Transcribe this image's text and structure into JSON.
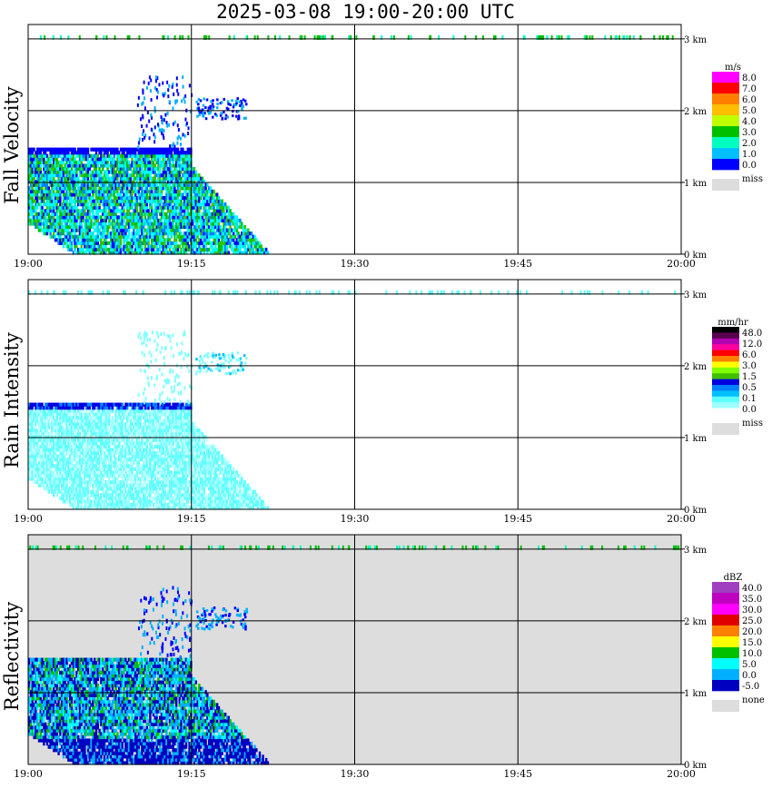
{
  "title": "2025-03-08  19:00-20:00 UTC",
  "chart_data": [
    {
      "type": "heatmap",
      "title": "Fall Velocity",
      "ylabel": "Fall Velocity",
      "x_ticks": [
        "19:00",
        "19:15",
        "19:30",
        "19:45",
        "20:00"
      ],
      "xlim_minutes": [
        0,
        60
      ],
      "y_ticks": [
        "0 km",
        "1 km",
        "2 km",
        "3 km"
      ],
      "ylim_km": [
        0,
        3.2
      ],
      "grid": true,
      "legend_placement": "right",
      "colorbar": {
        "unit": "m/s",
        "labels": [
          "8.0",
          "7.0",
          "6.0",
          "5.0",
          "4.0",
          "3.0",
          "2.0",
          "1.0",
          "0.0"
        ],
        "colors": [
          "#ff00ff",
          "#ff0000",
          "#ff7f00",
          "#ffbf00",
          "#bfff00",
          "#00bf00",
          "#00ffbf",
          "#00bfff",
          "#0000ff"
        ],
        "miss_label": "miss",
        "miss_color": "#dddddd"
      }
    },
    {
      "type": "heatmap",
      "title": "Rain Intensity",
      "ylabel": "Rain Intensity",
      "x_ticks": [
        "19:00",
        "19:15",
        "19:30",
        "19:45",
        "20:00"
      ],
      "xlim_minutes": [
        0,
        60
      ],
      "y_ticks": [
        "0 km",
        "1 km",
        "2 km",
        "3 km"
      ],
      "ylim_km": [
        0,
        3.2
      ],
      "grid": true,
      "legend_placement": "right",
      "colorbar": {
        "unit": "mm/hr",
        "labels": [
          "48.0",
          "12.0",
          "6.0",
          "3.0",
          "1.5",
          "0.5",
          "0.1",
          "0.0"
        ],
        "colors": [
          "#000000",
          "#5a0050",
          "#b000b0",
          "#ff00a0",
          "#ff0000",
          "#ff8000",
          "#ffff00",
          "#80ff00",
          "#40c000",
          "#0000e0",
          "#0080ff",
          "#00c0ff",
          "#60ffff",
          "#a0ffff",
          "#ffffff"
        ],
        "miss_label": "miss",
        "miss_color": "#dddddd"
      }
    },
    {
      "type": "heatmap",
      "title": "Reflectivity",
      "ylabel": "Reflectivity",
      "x_ticks": [
        "19:00",
        "19:15",
        "19:30",
        "19:45",
        "20:00"
      ],
      "xlim_minutes": [
        0,
        60
      ],
      "y_ticks": [
        "0 km",
        "1 km",
        "2 km",
        "3 km"
      ],
      "ylim_km": [
        0,
        3.2
      ],
      "grid": true,
      "legend_placement": "right",
      "background": "#dddddd",
      "colorbar": {
        "unit": "dBZ",
        "labels": [
          "40.0",
          "35.0",
          "30.0",
          "25.0",
          "20.0",
          "15.0",
          "10.0",
          "5.0",
          "0.0",
          "-5.0"
        ],
        "colors": [
          "#a040c0",
          "#c000c0",
          "#ff00ff",
          "#e00000",
          "#ff8000",
          "#ffff00",
          "#00c000",
          "#00ffff",
          "#00b0ff",
          "#0000c0"
        ],
        "miss_label": "none",
        "miss_color": "#dddddd"
      }
    }
  ]
}
